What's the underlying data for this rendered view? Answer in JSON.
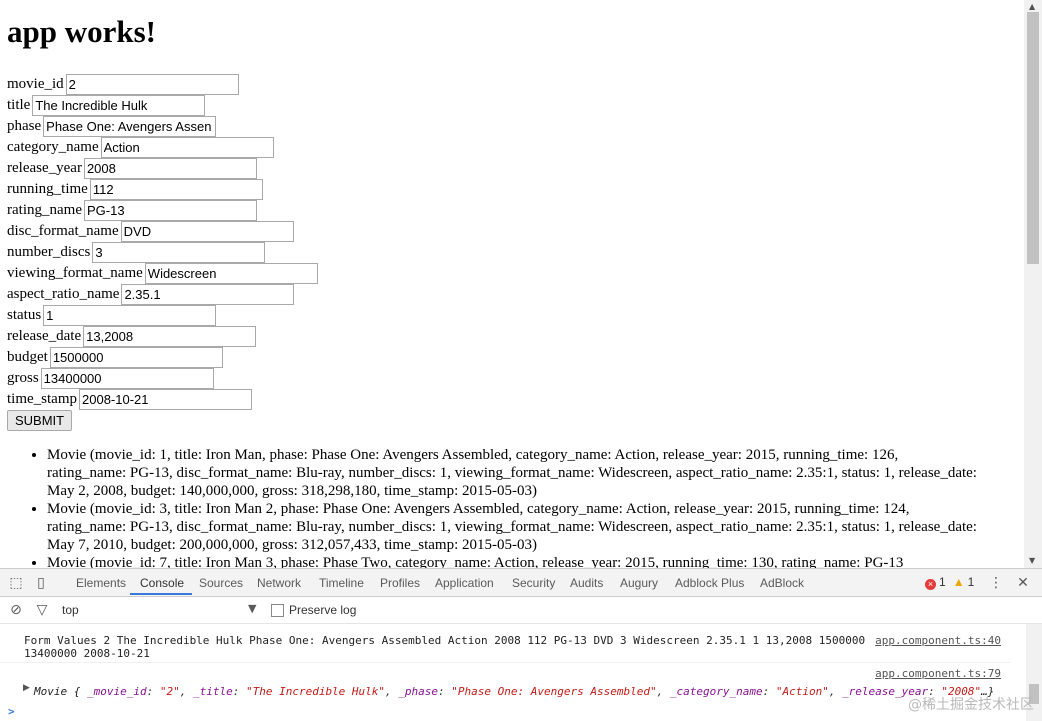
{
  "app": {
    "heading": "app works!",
    "fields": [
      {
        "label": "movie_id",
        "value": "2"
      },
      {
        "label": "title",
        "value": "The Incredible Hulk"
      },
      {
        "label": "phase",
        "value": "Phase One: Avengers Assen"
      },
      {
        "label": "category_name",
        "value": "Action"
      },
      {
        "label": "release_year",
        "value": "2008"
      },
      {
        "label": "running_time",
        "value": "112"
      },
      {
        "label": "rating_name",
        "value": "PG-13"
      },
      {
        "label": "disc_format_name",
        "value": "DVD"
      },
      {
        "label": "number_discs",
        "value": "3"
      },
      {
        "label": "viewing_format_name",
        "value": "Widescreen"
      },
      {
        "label": "aspect_ratio_name",
        "value": "2.35.1"
      },
      {
        "label": "status",
        "value": "1"
      },
      {
        "label": "release_date",
        "value": "13,2008"
      },
      {
        "label": "budget",
        "value": "1500000"
      },
      {
        "label": "gross",
        "value": "13400000"
      },
      {
        "label": "time_stamp",
        "value": "2008-10-21"
      }
    ],
    "submit_label": "SUBMIT",
    "movies": [
      "Movie (movie_id: 1, title: Iron Man, phase: Phase One: Avengers Assembled, category_name: Action, release_year: 2015, running_time: 126, rating_name: PG-13, disc_format_name: Blu-ray, number_discs: 1, viewing_format_name: Widescreen, aspect_ratio_name: 2.35:1, status: 1, release_date: May 2, 2008, budget: 140,000,000, gross: 318,298,180, time_stamp: 2015-05-03)",
      "Movie (movie_id: 3, title: Iron Man 2, phase: Phase One: Avengers Assembled, category_name: Action, release_year: 2015, running_time: 124, rating_name: PG-13, disc_format_name: Blu-ray, number_discs: 1, viewing_format_name: Widescreen, aspect_ratio_name: 2.35:1, status: 1, release_date: May 7, 2010, budget: 200,000,000, gross: 312,057,433, time_stamp: 2015-05-03)",
      "Movie (movie_id: 7, title: Iron Man 3, phase: Phase Two, category_name: Action, release_year: 2015, running_time: 130, rating_name: PG-13"
    ]
  },
  "devtools": {
    "tabs": [
      "Elements",
      "Console",
      "Sources",
      "Network",
      "Timeline",
      "Profiles",
      "Application",
      "Security",
      "Audits",
      "Augury",
      "Adblock Plus",
      "AdBlock"
    ],
    "active_tab": "Console",
    "error_count": "1",
    "warning_count": "1",
    "context": "top",
    "preserve_log_label": "Preserve log",
    "log1_text": "Form Values 2 The Incredible Hulk Phase One: Avengers Assembled Action 2008 112 PG-13 DVD 3 Widescreen 2.35.1 1 13,2008 1500000\n13400000 2008-10-21",
    "log1_source": "app.component.ts:40",
    "log2_source": "app.component.ts:79",
    "obj": {
      "prefix": "Movie {",
      "pairs": [
        {
          "k": "_movie_id",
          "v": "\"2\""
        },
        {
          "k": "_title",
          "v": "\"The Incredible Hulk\""
        },
        {
          "k": "_phase",
          "v": "\"Phase One: Avengers Assembled\""
        },
        {
          "k": "_category_name",
          "v": "\"Action\""
        },
        {
          "k": "_release_year",
          "v": "\"2008\""
        }
      ],
      "suffix": "…}"
    },
    "prompt": ">"
  },
  "watermark": "@稀土掘金技术社区"
}
